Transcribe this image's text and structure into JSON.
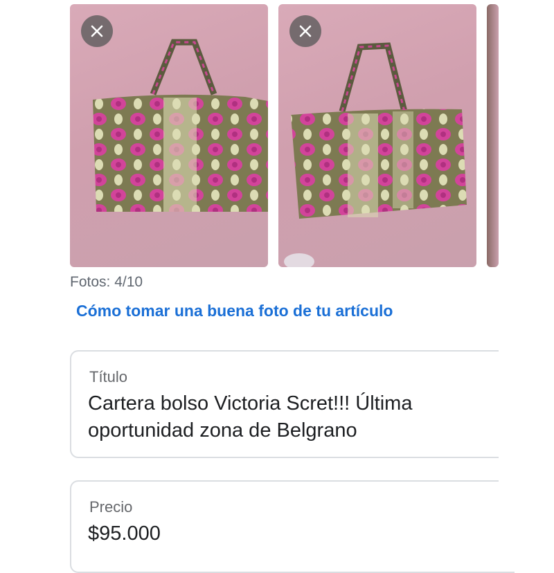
{
  "photos": {
    "items": [
      {
        "alt": "snakeskin-tote-bag"
      },
      {
        "alt": "snakeskin-tote-bag"
      },
      {
        "alt": "partial-next-photo"
      }
    ],
    "remove_icon": "close-icon",
    "count_text": "Fotos: 4/10"
  },
  "tips_link": "Cómo tomar una buena foto de tu artículo",
  "title_field": {
    "label": "Título",
    "value": "Cartera bolso Victoria Scret!!! Última oportunidad zona de Belgrano"
  },
  "price_field": {
    "label": "Precio",
    "value": "$95.000"
  },
  "colors": {
    "link": "#1a6fd6",
    "muted_text": "#606770",
    "border": "#dadde1",
    "bag_pink": "#d2449a",
    "bag_olive": "#7d7a52",
    "bag_cream": "#dcdcb4",
    "background_pink": "#d4a5b3"
  }
}
